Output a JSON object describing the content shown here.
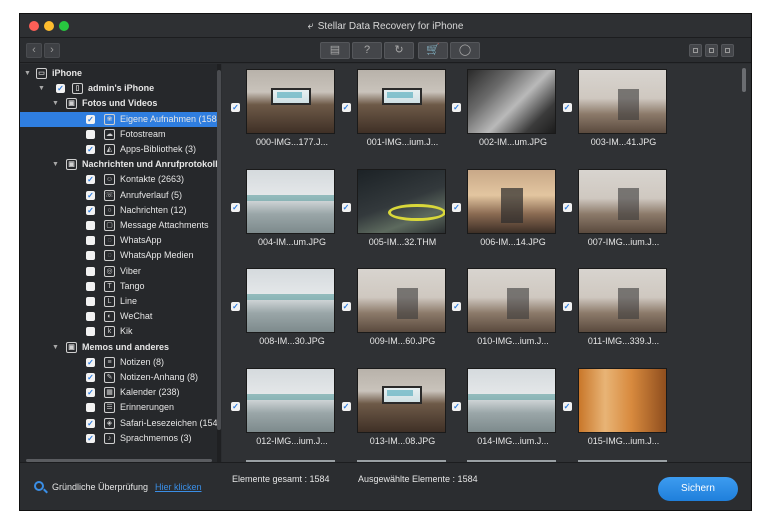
{
  "window": {
    "title": "Stellar Data Recovery for iPhone",
    "title_icon": "back-arrow-icon"
  },
  "toolbar": {
    "nav_back": "‹",
    "nav_forward": "›",
    "buttons": [
      {
        "name": "save-icon",
        "glyph": "▤"
      },
      {
        "name": "help-icon",
        "glyph": "?"
      },
      {
        "name": "refresh-icon",
        "glyph": "↻"
      },
      {
        "name": "cart-icon",
        "glyph": "🛒"
      },
      {
        "name": "user-icon",
        "glyph": "◯"
      }
    ],
    "view_modes": [
      "grid-view-icon",
      "list-view-icon",
      "preview-view-icon"
    ]
  },
  "sidebar": {
    "root": {
      "label": "iPhone",
      "icon": "computer-icon"
    },
    "device": {
      "label": "admin's iPhone",
      "icon": "phone-icon",
      "checked": true
    },
    "groups": [
      {
        "label": "Fotos und Videos",
        "icon": "photo-video-icon",
        "checked": true,
        "items": [
          {
            "label": "Eigene Aufnahmen (1584)",
            "icon": "camera-roll-icon",
            "checked": true,
            "selected": true,
            "glyph": "❀"
          },
          {
            "label": "Fotostream",
            "icon": "photostream-icon",
            "checked": false,
            "glyph": "☁"
          },
          {
            "label": "Apps-Bibliothek (3)",
            "icon": "app-library-icon",
            "checked": true,
            "glyph": "◭"
          }
        ]
      },
      {
        "label": "Nachrichten und Anrufprotokolle",
        "icon": "phone-log-icon",
        "checked": true,
        "items": [
          {
            "label": "Kontakte (2663)",
            "icon": "contacts-icon",
            "checked": true,
            "glyph": "☺"
          },
          {
            "label": "Anrufverlauf (5)",
            "icon": "call-history-icon",
            "checked": true,
            "glyph": "☏"
          },
          {
            "label": "Nachrichten (12)",
            "icon": "messages-icon",
            "checked": true,
            "glyph": "○"
          },
          {
            "label": "Message Attachments",
            "icon": "attachment-icon",
            "checked": false,
            "glyph": "▢"
          },
          {
            "label": "WhatsApp",
            "icon": "whatsapp-icon",
            "checked": false,
            "glyph": "◌"
          },
          {
            "label": "WhatsApp Medien",
            "icon": "whatsapp-media-icon",
            "checked": false,
            "glyph": "◌"
          },
          {
            "label": "Viber",
            "icon": "viber-icon",
            "checked": false,
            "glyph": "◎"
          },
          {
            "label": "Tango",
            "icon": "tango-icon",
            "checked": false,
            "glyph": "T"
          },
          {
            "label": "Line",
            "icon": "line-icon",
            "checked": false,
            "glyph": "L"
          },
          {
            "label": "WeChat",
            "icon": "wechat-icon",
            "checked": false,
            "glyph": "◐"
          },
          {
            "label": "Kik",
            "icon": "kik-icon",
            "checked": false,
            "glyph": "k"
          }
        ]
      },
      {
        "label": "Memos und anderes",
        "icon": "microphone-icon",
        "checked": true,
        "items": [
          {
            "label": "Notizen (8)",
            "icon": "notes-icon",
            "checked": true,
            "glyph": "≡"
          },
          {
            "label": "Notizen-Anhang (8)",
            "icon": "note-attachment-icon",
            "checked": true,
            "glyph": "✎"
          },
          {
            "label": "Kalender (238)",
            "icon": "calendar-icon",
            "checked": true,
            "glyph": "▦"
          },
          {
            "label": "Erinnerungen",
            "icon": "reminders-icon",
            "checked": false,
            "glyph": "☰"
          },
          {
            "label": "Safari-Lesezeichen (154)",
            "icon": "safari-icon",
            "checked": true,
            "glyph": "◈"
          },
          {
            "label": "Sprachmemos (3)",
            "icon": "voice-memo-icon",
            "checked": true,
            "glyph": "♪"
          }
        ]
      }
    ]
  },
  "grid": {
    "items": [
      {
        "name": "000-IMG...177.J...",
        "style": "img-office",
        "checked": true
      },
      {
        "name": "001-IMG...ium.J...",
        "style": "img-office",
        "checked": true
      },
      {
        "name": "002-IM...um.JPG",
        "style": "img-blur",
        "checked": true
      },
      {
        "name": "003-IM...41.JPG",
        "style": "img-desk",
        "checked": true
      },
      {
        "name": "004-IM...um.JPG",
        "style": "img-corr",
        "checked": true
      },
      {
        "name": "005-IM...32.THM",
        "style": "img-dark",
        "checked": true
      },
      {
        "name": "006-IM...14.JPG",
        "style": "img-warm",
        "checked": true
      },
      {
        "name": "007-IMG...ium.J...",
        "style": "img-desk",
        "checked": true
      },
      {
        "name": "008-IM...30.JPG",
        "style": "img-corr",
        "checked": true
      },
      {
        "name": "009-IM...60.JPG",
        "style": "img-desk",
        "checked": true
      },
      {
        "name": "010-IMG...ium.J...",
        "style": "img-desk",
        "checked": true
      },
      {
        "name": "011-IMG...339.J...",
        "style": "img-desk",
        "checked": true
      },
      {
        "name": "012-IMG...ium.J...",
        "style": "img-corr",
        "checked": true
      },
      {
        "name": "013-IM...08.JPG",
        "style": "img-office",
        "checked": true
      },
      {
        "name": "014-IMG...ium.J...",
        "style": "img-corr",
        "checked": true
      },
      {
        "name": "015-IMG...ium.J...",
        "style": "img-orange",
        "checked": true
      }
    ]
  },
  "footer": {
    "deep_scan_label": "Gründliche Überprüfung",
    "deep_scan_link": "Hier klicken",
    "total_items": "Elemente gesamt : 1584",
    "selected_items": "Ausgewählte Elemente : 1584",
    "search_button": "Sichern"
  },
  "colors": {
    "accent": "#2f7ee0",
    "window_bg": "#2b2d30",
    "sidebar_bg": "#26282b",
    "grid_bg": "#2f3134"
  }
}
